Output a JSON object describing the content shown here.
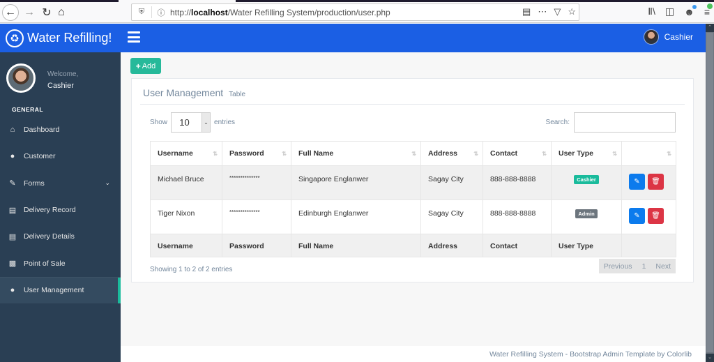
{
  "browser": {
    "url_prefix": "http://",
    "url_host": "localhost",
    "url_path": "/Water Refilling System/production/user.php",
    "icons": [
      "back-icon",
      "forward-icon",
      "reload-icon",
      "home-icon",
      "shield-icon",
      "info-icon",
      "reader-icon",
      "more-icon",
      "pocket-icon",
      "star-icon",
      "library-icon",
      "sidebar-icon",
      "account-icon",
      "menu-icon"
    ]
  },
  "app": {
    "brand_title": "Water Refilling!",
    "brand_icon": "recycle-icon",
    "user_menu_name": "Cashier"
  },
  "sidebar": {
    "welcome": "Welcome,",
    "user_name": "Cashier",
    "section_title": "GENERAL",
    "items": [
      {
        "label": "Dashboard",
        "icon": "home-icon"
      },
      {
        "label": "Customer",
        "icon": "user-icon"
      },
      {
        "label": "Forms",
        "icon": "edit-icon",
        "has_submenu": true
      },
      {
        "label": "Delivery Record",
        "icon": "book-icon"
      },
      {
        "label": "Delivery Details",
        "icon": "list-alt-icon"
      },
      {
        "label": "Point of Sale",
        "icon": "bar-chart-icon"
      },
      {
        "label": "User Management",
        "icon": "user-icon",
        "active": true
      }
    ]
  },
  "main": {
    "add_button": "Add",
    "panel_title": "User Management",
    "panel_subtitle": "Table",
    "length": {
      "show": "Show",
      "value": "10",
      "entries": "entries"
    },
    "search": {
      "label": "Search:",
      "value": "",
      "placeholder": ""
    },
    "table": {
      "columns": [
        "Username",
        "Password",
        "Full Name",
        "Address",
        "Contact",
        "User Type",
        ""
      ],
      "rows": [
        {
          "username": "Michael Bruce",
          "password": "**************",
          "full_name": "Singapore Englanwer",
          "address": "Sagay City",
          "contact": "888-888-8888",
          "user_type": "Cashier"
        },
        {
          "username": "Tiger Nixon",
          "password": "**************",
          "full_name": "Edinburgh Englanwer",
          "address": "Sagay City",
          "contact": "888-888-8888",
          "user_type": "Admin"
        }
      ],
      "footer_columns": [
        "Username",
        "Password",
        "Full Name",
        "Address",
        "Contact",
        "User Type",
        ""
      ]
    },
    "info": "Showing 1 to 2 of 2 entries",
    "pagination": {
      "previous": "Previous",
      "current": "1",
      "next": "Next"
    }
  },
  "footer": {
    "text": "Water Refilling System - Bootstrap Admin Template by Colorlib"
  },
  "colors": {
    "appbar": "#1b5fe4",
    "sidebar": "#2a3f54",
    "accent_green": "#1abb9c",
    "edit_blue": "#0c7bed",
    "delete_red": "#dc3545",
    "admin_gray": "#6c757d"
  }
}
